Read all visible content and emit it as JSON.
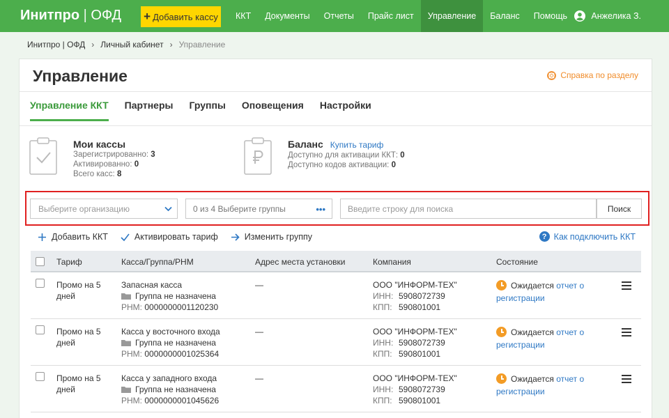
{
  "brand": {
    "name": "Инитпро",
    "separator": "|",
    "suffix": "ОФД"
  },
  "header": {
    "add_button": "Добавить кассу",
    "nav": [
      "ККТ",
      "Документы",
      "Отчеты",
      "Прайс лист",
      "Управление",
      "Баланс",
      "Помощь"
    ],
    "active_nav": "Управление",
    "user_name": "Анжелика З."
  },
  "breadcrumb": [
    "Инитпро | ОФД",
    "Личный кабинет",
    "Управление"
  ],
  "page": {
    "title": "Управление",
    "help_link": "Справка по разделу"
  },
  "tabs": [
    "Управление ККТ",
    "Партнеры",
    "Группы",
    "Оповещения",
    "Настройки"
  ],
  "stats": {
    "my_kassas": {
      "title": "Мои кассы",
      "registered_label": "Зарегистрированно:",
      "registered_value": "3",
      "activated_label": "Активированно:",
      "activated_value": "0",
      "total_label": "Всего касс:",
      "total_value": "8"
    },
    "balance": {
      "title": "Баланс",
      "buy_link": "Купить тариф",
      "available_kkt_label": "Доступно для активации ККТ:",
      "available_kkt_value": "0",
      "available_codes_label": "Доступно кодов активации:",
      "available_codes_value": "0"
    }
  },
  "filters": {
    "org_placeholder": "Выберите организацию",
    "group_text": "0 из 4 Выберите группы",
    "group_more": "•••",
    "search_placeholder": "Введите строку для поиска",
    "search_button": "Поиск"
  },
  "actions": {
    "add_kkt": "Добавить ККТ",
    "activate_tariff": "Активировать тариф",
    "change_group": "Изменить группу",
    "how_connect": "Как подключить ККТ"
  },
  "table": {
    "columns": [
      "Тариф",
      "Касса/Группа/РНМ",
      "Адрес места установки",
      "Компания",
      "Состояние"
    ],
    "rows": [
      {
        "tariff_1": "Промо на 5",
        "tariff_2": "дней",
        "kassa": "Запасная касса",
        "group": "Группа не назначена",
        "rnm_label": "РНМ:",
        "rnm": "0000000001120230",
        "address": "—",
        "company": "ООО \"ИНФОРМ-ТЕХ\"",
        "inn_label": "ИНН:",
        "inn": "5908072739",
        "kpp_label": "КПП:",
        "kpp": "590801001",
        "state": "Ожидается",
        "state_link_1": "отчет о",
        "state_link_2": "регистрации"
      },
      {
        "tariff_1": "Промо на 5",
        "tariff_2": "дней",
        "kassa": "Касса у восточного входа",
        "group": "Группа не назначена",
        "rnm_label": "РНМ:",
        "rnm": "0000000001025364",
        "address": "—",
        "company": "ООО \"ИНФОРМ-ТЕХ\"",
        "inn_label": "ИНН:",
        "inn": "5908072739",
        "kpp_label": "КПП:",
        "kpp": "590801001",
        "state": "Ожидается",
        "state_link_1": "отчет о",
        "state_link_2": "регистрации"
      },
      {
        "tariff_1": "Промо на 5",
        "tariff_2": "дней",
        "kassa": "Касса у западного входа",
        "group": "Группа не назначена",
        "rnm_label": "РНМ:",
        "rnm": "0000000001045626",
        "address": "—",
        "company": "ООО \"ИНФОРМ-ТЕХ\"",
        "inn_label": "ИНН:",
        "inn": "5908072739",
        "kpp_label": "КПП:",
        "kpp": "590801001",
        "state": "Ожидается",
        "state_link_1": "отчет о",
        "state_link_2": "регистрации"
      }
    ]
  },
  "colors": {
    "brand_green": "#4cae4c",
    "nav_active": "#3e913e",
    "add_button_yellow": "#ffd600",
    "link_blue": "#2e78c4",
    "help_orange": "#f08c2a",
    "status_orange": "#f39c26",
    "highlight_red": "#e02020"
  }
}
